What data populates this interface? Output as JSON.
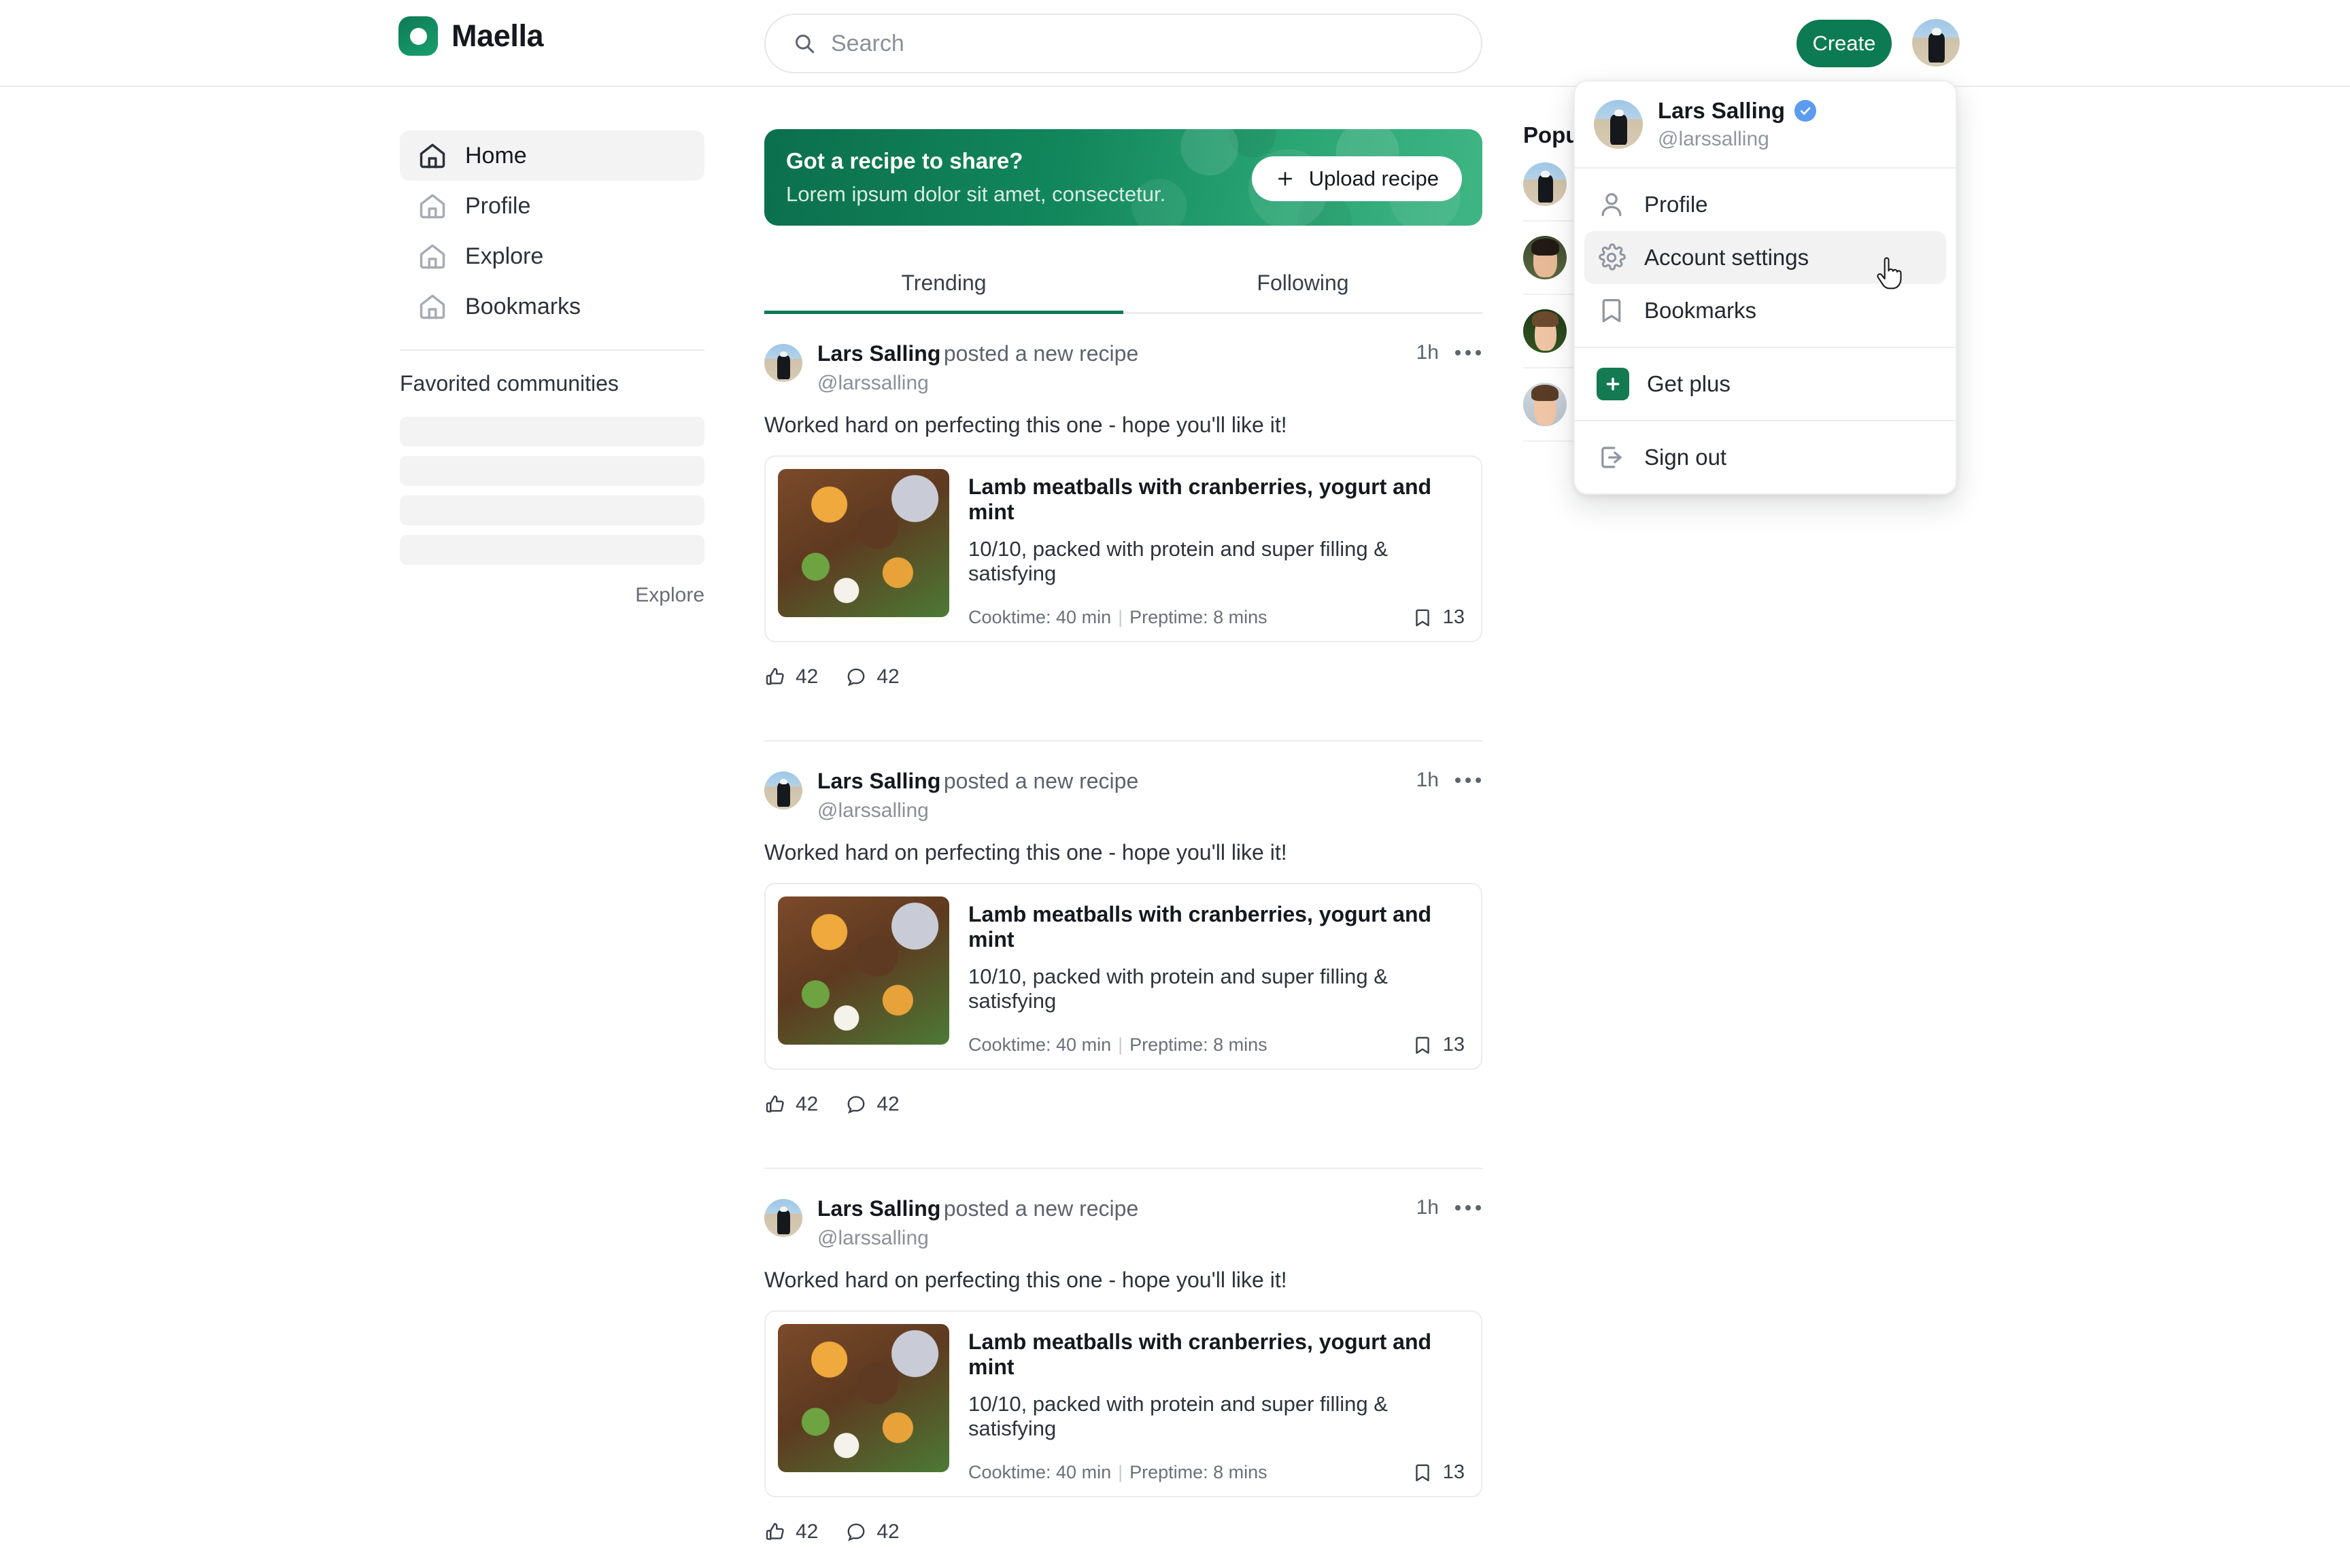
{
  "brand": {
    "name": "Maella",
    "logo_icon": "circle-logo-icon",
    "accent": "#0c7a52"
  },
  "search": {
    "placeholder": "Search",
    "icon": "search-icon"
  },
  "header": {
    "create_label": "Create",
    "avatar_alt": "Lars Salling"
  },
  "sidebar": {
    "items": [
      {
        "label": "Home",
        "icon": "home-icon",
        "active": true
      },
      {
        "label": "Profile",
        "icon": "home-icon",
        "active": false
      },
      {
        "label": "Explore",
        "icon": "home-icon",
        "active": false
      },
      {
        "label": "Bookmarks",
        "icon": "home-icon",
        "active": false
      }
    ],
    "section_title": "Favorited communities",
    "placeholder_count": 4,
    "explore_link": "Explore"
  },
  "promo": {
    "title": "Got a recipe to share?",
    "subtitle": "Lorem ipsum dolor sit amet, consectetur.",
    "button_label": "Upload recipe",
    "button_icon": "plus-icon",
    "bg_color": "#0b6f4d"
  },
  "tabs": [
    {
      "label": "Trending",
      "active": true
    },
    {
      "label": "Following",
      "active": false
    }
  ],
  "posts": [
    {
      "author": "Lars Salling",
      "action": "posted a new recipe",
      "handle": "@larssalling",
      "time": "1h",
      "text": "Worked hard on perfecting this one - hope you'll like it!",
      "recipe": {
        "title": "Lamb meatballs with cranberries, yogurt and mint",
        "subtitle": "10/10, packed with protein and super filling & satisfying",
        "cooktime": "Cooktime: 40 min",
        "preptime": "Preptime: 8 mins",
        "bookmark_count": "13"
      },
      "likes": "42",
      "comments": "42"
    },
    {
      "author": "Lars Salling",
      "action": "posted a new recipe",
      "handle": "@larssalling",
      "time": "1h",
      "text": "Worked hard on perfecting this one - hope you'll like it!",
      "recipe": {
        "title": "Lamb meatballs with cranberries, yogurt and mint",
        "subtitle": "10/10, packed with protein and super filling & satisfying",
        "cooktime": "Cooktime: 40 min",
        "preptime": "Preptime: 8 mins",
        "bookmark_count": "13"
      },
      "likes": "42",
      "comments": "42"
    },
    {
      "author": "Lars Salling",
      "action": "posted a new recipe",
      "handle": "@larssalling",
      "time": "1h",
      "text": "Worked hard on perfecting this one - hope you'll like it!",
      "recipe": {
        "title": "Lamb meatballs with cranberries, yogurt and mint",
        "subtitle": "10/10, packed with protein and super filling & satisfying",
        "cooktime": "Cooktime: 40 min",
        "preptime": "Preptime: 8 mins",
        "bookmark_count": "13"
      },
      "likes": "42",
      "comments": "42"
    }
  ],
  "right_column": {
    "title": "Popular",
    "items": [
      {
        "avatar": "lars"
      },
      {
        "avatar": "w1"
      },
      {
        "avatar": "w2"
      },
      {
        "avatar": "w3"
      }
    ]
  },
  "account_menu": {
    "user_name": "Lars Salling",
    "user_handle": "@larssalling",
    "verified_icon": "verified-badge-icon",
    "items": [
      {
        "label": "Profile",
        "icon": "person-icon",
        "hover": false
      },
      {
        "label": "Account settings",
        "icon": "gear-icon",
        "hover": true
      },
      {
        "label": "Bookmarks",
        "icon": "bookmark-icon",
        "hover": false
      }
    ],
    "plus_label": "Get plus",
    "plus_icon": "plus-square-icon",
    "signout_label": "Sign out",
    "signout_icon": "sign-out-icon"
  }
}
